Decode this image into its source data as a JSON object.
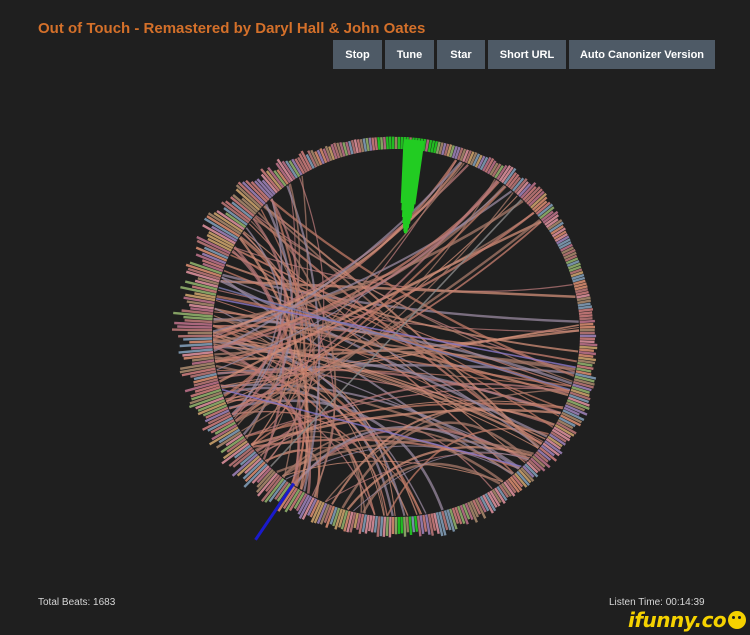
{
  "header": {
    "title": "Out of Touch - Remastered by Daryl Hall & John Oates"
  },
  "toolbar": {
    "stop_label": "Stop",
    "tune_label": "Tune",
    "star_label": "Star",
    "short_url_label": "Short URL",
    "auto_canonizer_label": "Auto Canonizer Version"
  },
  "footer": {
    "total_beats": "Total Beats: 1683",
    "listen_time": "Listen Time: 00:14:39"
  },
  "watermark": {
    "text": "ifunny.co"
  },
  "visualization": {
    "beat_count": 1683,
    "colors": {
      "background": "#1f1f1f",
      "ring_base": "#c97a7a",
      "current_beat": "#22cc22",
      "highlight_edge": "#1a1acc",
      "arc_primary": "#c98070",
      "arc_secondary": "#8a78c8",
      "title": "#d4702a"
    }
  }
}
